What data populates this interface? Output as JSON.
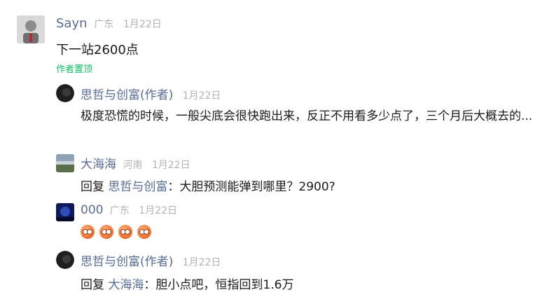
{
  "comments": [
    {
      "author": "Sayn",
      "location": "广东",
      "date": "1月22日",
      "text": "下一站2600点",
      "pin_label": "作者置顶"
    }
  ],
  "replies": [
    {
      "author": "思哲与创富(作者)",
      "location": "",
      "date": "1月22日",
      "text": "极度恐慌的时候，一般尖底会很快跑出来，反正不用看多少点了，三个月后大概去的..."
    },
    {
      "author": "大海海",
      "location": "河南",
      "date": "1月22日",
      "reply_prefix": "回复",
      "reply_to": "思哲与创富",
      "text": "：大胆预测能弹到哪里？2900?"
    },
    {
      "author": "000",
      "location": "广东",
      "date": "1月22日",
      "emoji_icons": [
        "emoji-icon",
        "emoji-icon",
        "emoji-icon",
        "emoji-icon"
      ]
    },
    {
      "author": "思哲与创富(作者)",
      "location": "",
      "date": "1月22日",
      "reply_prefix": "回复",
      "reply_to": "大海海",
      "text": "：胆小点吧，恒指回到1.6万"
    }
  ],
  "colors": {
    "name": "#576b95",
    "meta": "#b2b2b2",
    "pin": "#07c160",
    "text": "#1a1a1a"
  }
}
